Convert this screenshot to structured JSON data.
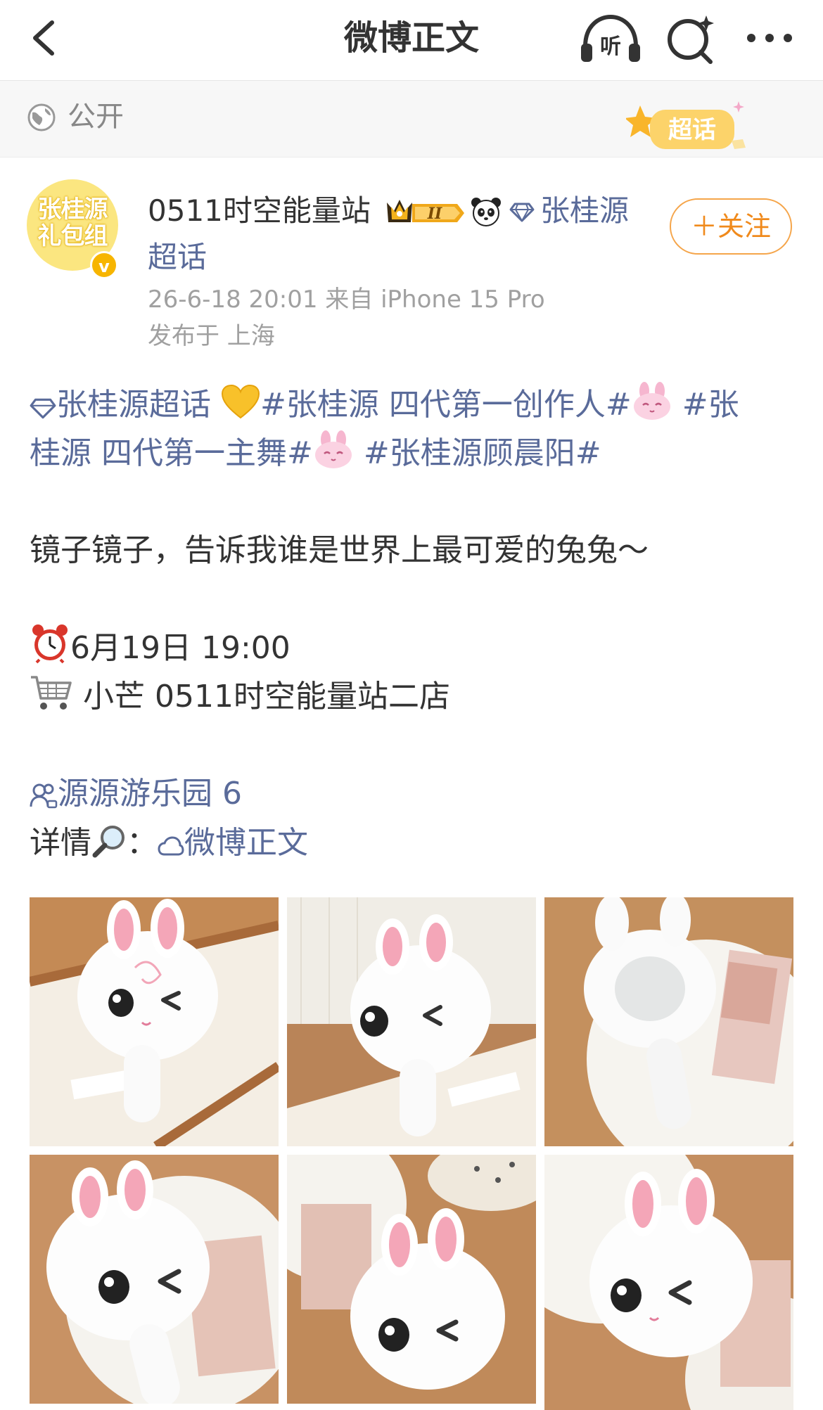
{
  "nav": {
    "title": "微博正文",
    "listen_label": "听"
  },
  "visibility": {
    "label": "公开",
    "badge_label": "超话"
  },
  "author": {
    "avatar_text_line1": "张桂源",
    "avatar_text_line2": "礼包组",
    "verified_mark": "v",
    "name": "0511时空能量站",
    "crown_level": "II",
    "topic_part1": "张桂源",
    "topic_part2": "超话",
    "follow_label": "＋关注",
    "meta": "26-6-18 20:01  来自 iPhone 15 Pro",
    "location": "发布于 上海"
  },
  "post": {
    "line1_topic": "张桂源超话",
    "line1_tag": "#张桂源 四代第一创作人#",
    "line1_tag2": "#张",
    "line2_tag": "桂源 四代第一主舞#",
    "line2_tag3": "#张桂源顾晨阳#",
    "line3": "镜子镜子，告诉我谁是世界上最可爱的兔兔～",
    "line4": "6月19日 19:00",
    "line5": "小芒  0511时空能量站二店",
    "line6": "源源游乐园 6",
    "line7_label": "详情",
    "line7_sep": "：",
    "line7_link": "微博正文"
  },
  "colors": {
    "link": "#5a6b9a",
    "follow": "#f08a1c",
    "meta": "#a0a0a0",
    "avatar_bg": "#fbe680"
  },
  "icons": [
    "back-arrow-icon",
    "listen-icon",
    "search-sparkle-icon",
    "more-icon",
    "globe-icon",
    "chaohua-star-badge",
    "crown-icon",
    "panda-icon",
    "diamond-icon",
    "yellow-heart-icon",
    "pink-bunny-icon",
    "alarm-clock-icon",
    "shopping-cart-icon",
    "user-group-icon",
    "magnifier-icon",
    "cloud-link-icon"
  ]
}
